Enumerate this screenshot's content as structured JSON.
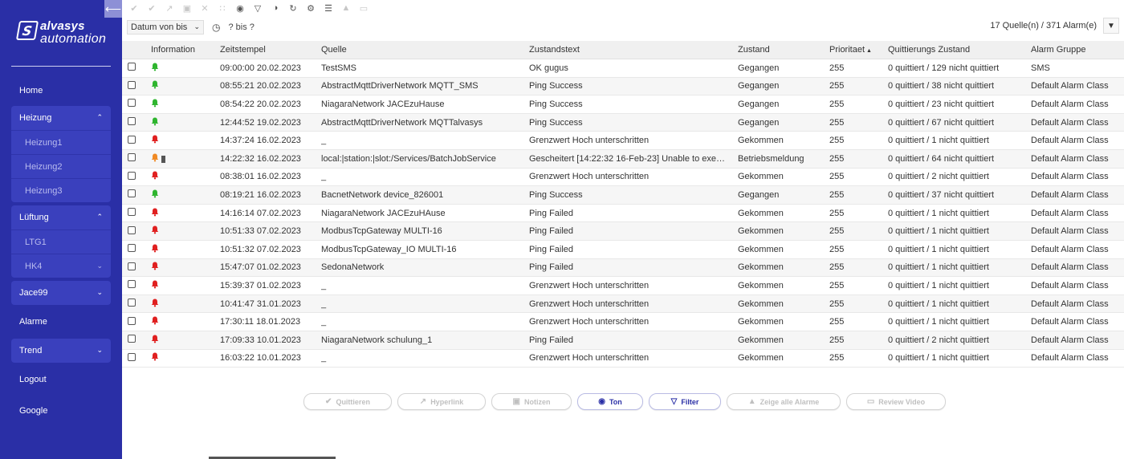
{
  "brand": {
    "name": "alvasys",
    "sub": "automation",
    "mark": "S"
  },
  "sidebar": {
    "collapse_glyph": "⟵",
    "items": [
      {
        "label": "Home"
      },
      {
        "label": "Heizung",
        "children": [
          "Heizung1",
          "Heizung2",
          "Heizung3"
        ]
      },
      {
        "label": "Lüftung",
        "children": [
          "LTG1",
          "HK4"
        ]
      },
      {
        "label": "Jace99"
      },
      {
        "label": "Alarme"
      },
      {
        "label": "Trend"
      },
      {
        "label": "Logout"
      },
      {
        "label": "Google"
      }
    ]
  },
  "toolbar": {
    "icons": [
      "acknowledge-icon",
      "acknowledge-all-icon",
      "hyperlink-icon",
      "notes-icon",
      "unacknowledge-icon",
      "grid-icon",
      "sound-icon",
      "filter-icon",
      "volume-icon",
      "refresh-icon",
      "settings-icon",
      "report-icon",
      "bell-icon",
      "video-icon"
    ]
  },
  "filter": {
    "date_select": "Datum von bis",
    "range_text": "? bis ?",
    "summary": "17 Quelle(n) / 371 Alarm(e)"
  },
  "table": {
    "headers": {
      "info": "Information",
      "time": "Zeitstempel",
      "source": "Quelle",
      "text": "Zustandstext",
      "state": "Zustand",
      "prio": "Prioritaet",
      "ack": "Quittierungs Zustand",
      "group": "Alarm Gruppe"
    },
    "rows": [
      {
        "status": "green",
        "time": "09:00:00 20.02.2023",
        "source": "TestSMS",
        "text": "OK gugus",
        "state": "Gegangen",
        "prio": "255",
        "ack": "0 quittiert / 129 nicht quittiert",
        "group": "SMS"
      },
      {
        "status": "green",
        "time": "08:55:21 20.02.2023",
        "source": "AbstractMqttDriverNetwork MQTT_SMS",
        "text": "Ping Success",
        "state": "Gegangen",
        "prio": "255",
        "ack": "0 quittiert / 38 nicht quittiert",
        "group": "Default Alarm Class"
      },
      {
        "status": "green",
        "time": "08:54:22 20.02.2023",
        "source": "NiagaraNetwork JACEzuHause",
        "text": "Ping Success",
        "state": "Gegangen",
        "prio": "255",
        "ack": "0 quittiert / 23 nicht quittiert",
        "group": "Default Alarm Class"
      },
      {
        "status": "green",
        "time": "12:44:52 19.02.2023",
        "source": "AbstractMqttDriverNetwork MQTTalvasys",
        "text": "Ping Success",
        "state": "Gegangen",
        "prio": "255",
        "ack": "0 quittiert / 67 nicht quittiert",
        "group": "Default Alarm Class"
      },
      {
        "status": "red",
        "time": "14:37:24 16.02.2023",
        "source": "_",
        "text": "Grenzwert Hoch unterschritten",
        "state": "Gekommen",
        "prio": "255",
        "ack": "0 quittiert / 1 nicht quittiert",
        "group": "Default Alarm Class"
      },
      {
        "status": "orange",
        "time": "14:22:32 16.02.2023",
        "source": "local:|station:|slot:/Services/BatchJobService",
        "text": "Gescheitert [14:22:32 16-Feb-23] Unable to exe…",
        "state": "Betriebsmeldung",
        "prio": "255",
        "ack": "0 quittiert / 64 nicht quittiert",
        "group": "Default Alarm Class"
      },
      {
        "status": "red",
        "time": "08:38:01 16.02.2023",
        "source": "_",
        "text": "Grenzwert Hoch unterschritten",
        "state": "Gekommen",
        "prio": "255",
        "ack": "0 quittiert / 2 nicht quittiert",
        "group": "Default Alarm Class"
      },
      {
        "status": "green",
        "time": "08:19:21 16.02.2023",
        "source": "BacnetNetwork device_826001",
        "text": "Ping Success",
        "state": "Gegangen",
        "prio": "255",
        "ack": "0 quittiert / 37 nicht quittiert",
        "group": "Default Alarm Class"
      },
      {
        "status": "red",
        "time": "14:16:14 07.02.2023",
        "source": "NiagaraNetwork JACEzuHAuse",
        "text": "Ping Failed",
        "state": "Gekommen",
        "prio": "255",
        "ack": "0 quittiert / 1 nicht quittiert",
        "group": "Default Alarm Class"
      },
      {
        "status": "red",
        "time": "10:51:33 07.02.2023",
        "source": "ModbusTcpGateway MULTI-16",
        "text": "Ping Failed",
        "state": "Gekommen",
        "prio": "255",
        "ack": "0 quittiert / 1 nicht quittiert",
        "group": "Default Alarm Class"
      },
      {
        "status": "red",
        "time": "10:51:32 07.02.2023",
        "source": "ModbusTcpGateway_IO MULTI-16",
        "text": "Ping Failed",
        "state": "Gekommen",
        "prio": "255",
        "ack": "0 quittiert / 1 nicht quittiert",
        "group": "Default Alarm Class"
      },
      {
        "status": "red",
        "time": "15:47:07 01.02.2023",
        "source": "SedonaNetwork",
        "text": "Ping Failed",
        "state": "Gekommen",
        "prio": "255",
        "ack": "0 quittiert / 1 nicht quittiert",
        "group": "Default Alarm Class"
      },
      {
        "status": "red",
        "time": "15:39:37 01.02.2023",
        "source": "_",
        "text": "Grenzwert Hoch unterschritten",
        "state": "Gekommen",
        "prio": "255",
        "ack": "0 quittiert / 1 nicht quittiert",
        "group": "Default Alarm Class"
      },
      {
        "status": "red",
        "time": "10:41:47 31.01.2023",
        "source": "_",
        "text": "Grenzwert Hoch unterschritten",
        "state": "Gekommen",
        "prio": "255",
        "ack": "0 quittiert / 1 nicht quittiert",
        "group": "Default Alarm Class"
      },
      {
        "status": "red",
        "time": "17:30:11 18.01.2023",
        "source": "_",
        "text": "Grenzwert Hoch unterschritten",
        "state": "Gekommen",
        "prio": "255",
        "ack": "0 quittiert / 1 nicht quittiert",
        "group": "Default Alarm Class"
      },
      {
        "status": "red",
        "time": "17:09:33 10.01.2023",
        "source": "NiagaraNetwork schulung_1",
        "text": "Ping Failed",
        "state": "Gekommen",
        "prio": "255",
        "ack": "0 quittiert / 2 nicht quittiert",
        "group": "Default Alarm Class"
      },
      {
        "status": "red",
        "time": "16:03:22 10.01.2023",
        "source": "_",
        "text": "Grenzwert Hoch unterschritten",
        "state": "Gekommen",
        "prio": "255",
        "ack": "0 quittiert / 1 nicht quittiert",
        "group": "Default Alarm Class"
      }
    ]
  },
  "buttons": [
    {
      "name": "quittieren",
      "label": "Quittieren",
      "icon": "acknowledge-icon",
      "active": false
    },
    {
      "name": "hyperlink",
      "label": "Hyperlink",
      "icon": "hyperlink-icon",
      "active": false
    },
    {
      "name": "notizen",
      "label": "Notizen",
      "icon": "notes-icon",
      "active": false
    },
    {
      "name": "ton",
      "label": "Ton",
      "icon": "sound-icon",
      "active": true
    },
    {
      "name": "filter",
      "label": "Filter",
      "icon": "filter-icon",
      "active": true
    },
    {
      "name": "zeige-alle-alarme",
      "label": "Zeige alle Alarme",
      "icon": "bell-icon",
      "active": false
    },
    {
      "name": "review-video",
      "label": "Review Video",
      "icon": "video-icon",
      "active": false
    }
  ],
  "colors": {
    "sidebar": "#2a2fa6",
    "accent": "#2a2fa6",
    "green": "#2fb52f",
    "red": "#e02020",
    "orange": "#f08a24"
  }
}
